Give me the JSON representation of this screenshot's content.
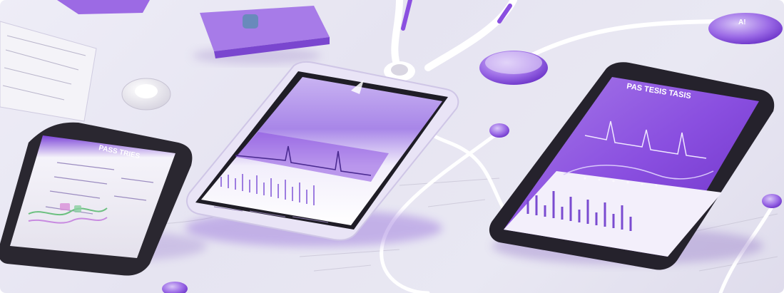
{
  "scene": {
    "description_colors": {
      "accent": "#8a4fe0",
      "accent_dark": "#6a2fc4",
      "accent_light": "#c9b3f2",
      "background": "#e8e6f2",
      "device_frame": "#2a2730"
    },
    "left_phone": {
      "header_text": "PASS TRIES"
    },
    "right_phone": {
      "header_text": "PAS TESIS TASIS"
    },
    "earbud_case": {
      "badge_text": "A!"
    }
  }
}
